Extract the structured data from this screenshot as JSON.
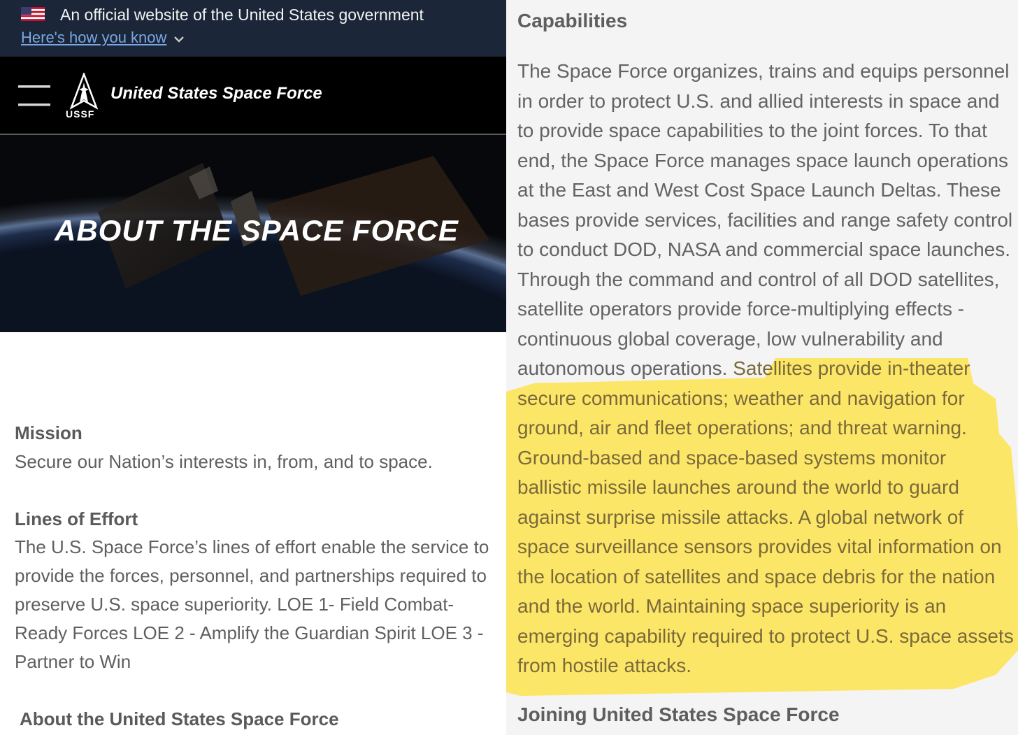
{
  "gov_banner": {
    "text": "An official website of the United States government",
    "link": "Here's how you know"
  },
  "header": {
    "logo_label": "USSF",
    "org_name": "United States Space Force"
  },
  "hero": {
    "title": "ABOUT THE SPACE FORCE"
  },
  "mission": {
    "heading": "Mission",
    "text": "Secure our Nation’s interests in, from, and to space."
  },
  "lines_of_effort": {
    "heading": "Lines of Effort",
    "text": "The U.S. Space Force’s lines of effort enable the service to provide the forces, personnel, and partnerships required to preserve U.S. space superiority. LOE 1- Field Combat-Ready Forces  LOE 2 - Amplify the Guardian Spirit LOE 3 - Partner to Win"
  },
  "about_heading": "About the United States Space Force",
  "capabilities": {
    "heading": "Capabilities",
    "text": "The Space Force organizes, trains and equips personnel in order to protect U.S. and allied interests in space and to provide space capabilities to the joint forces. To that end, the Space Force manages space launch operations at the East and West Cost Space Launch Deltas.  These bases provide services, facilities and range safety control to conduct DOD, NASA and commercial space launches. Through the command and control of all DOD satellites, satellite operators provide force-multiplying effects - continuous global coverage, low vulnerability and autonomous operations. ",
    "highlighted_text": "Satellites provide in-theater secure communications; weather and navigation for ground, air and fleet operations; and threat warning. Ground-based and space-based systems monitor ballistic missile launches around the world to guard against surprise missile attacks. A global network of space surveillance sensors provides vital information on the location of satellites and space debris for the nation and the world. Maintaining space superiority is an emerging capability required to protect U.S. space assets from hostile attacks.",
    "highlight_color": "#fde34f"
  },
  "joining_heading": "Joining United States Space Force"
}
